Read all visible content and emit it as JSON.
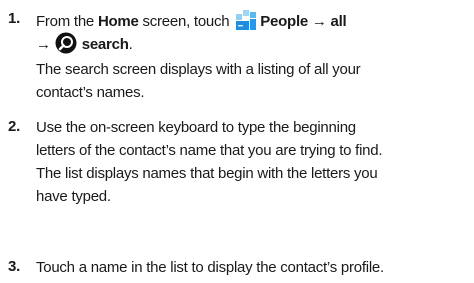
{
  "steps": [
    {
      "number": "1.",
      "instruction": {
        "pre": "From the ",
        "home": "Home",
        "mid": " screen, touch ",
        "people_path": "People → all",
        "arrow": "→",
        "search": "search",
        "end": "."
      },
      "result": [
        "The search screen displays with a listing of all your",
        "contact’s names."
      ]
    },
    {
      "number": "2.",
      "lines": [
        "Use the on-screen keyboard to type the beginning",
        "letters of the contact’s name that you are trying to find.",
        "The list displays names that begin with the letters you",
        "have typed."
      ]
    },
    {
      "number": "3.",
      "lines": [
        "Touch a name in the list to display the contact’s profile."
      ]
    }
  ],
  "icons": {
    "people_tile": "people-hub-icon",
    "search": "search-icon"
  },
  "colors": {
    "tile_blue": "#1e8fe0",
    "tile_light": "#8fd0f5",
    "text": "#1a1a1a"
  }
}
